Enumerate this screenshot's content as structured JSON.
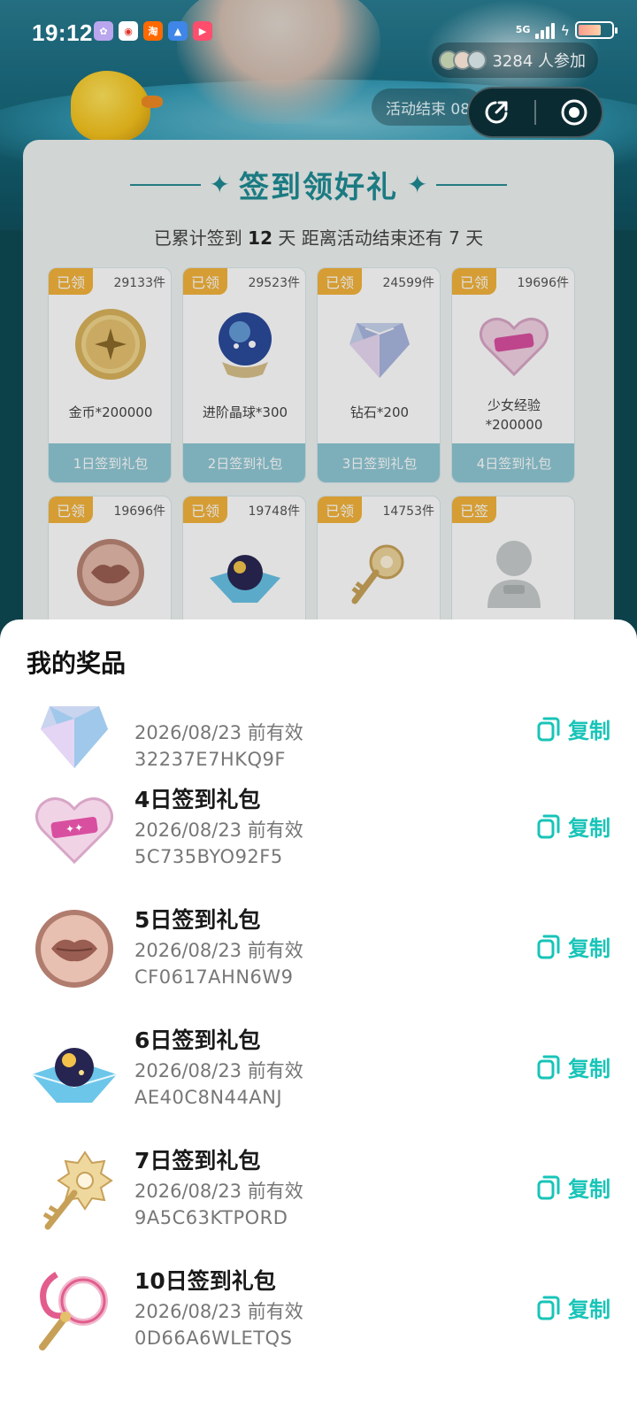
{
  "status_bar": {
    "time": "19:12",
    "network": "5G",
    "notif_apps": [
      "app-a",
      "weibo",
      "taobao",
      "game",
      "video"
    ]
  },
  "banner": {
    "participants": "3284 人参加",
    "end_tag": "活动结束 08"
  },
  "card": {
    "title": "签到领好礼",
    "sub_prefix": "已累计签到",
    "days": "12",
    "sub_mid": "天  距离活动结束还有",
    "remain": "7",
    "sub_suffix": "天",
    "gifts": [
      {
        "badge": "已领",
        "count": "29133件",
        "name": "金币*200000",
        "foot": "1日签到礼包",
        "icon": "gold-coin"
      },
      {
        "badge": "已领",
        "count": "29523件",
        "name": "进阶晶球*300",
        "foot": "2日签到礼包",
        "icon": "crystal-ball"
      },
      {
        "badge": "已领",
        "count": "24599件",
        "name": "钻石*200",
        "foot": "3日签到礼包",
        "icon": "diamond"
      },
      {
        "badge": "已领",
        "count": "19696件",
        "name": "少女经验*200000",
        "foot": "4日签到礼包",
        "icon": "heart-badge"
      },
      {
        "badge": "已领",
        "count": "19696件",
        "name": "",
        "foot": "",
        "icon": "lips-coin"
      },
      {
        "badge": "已领",
        "count": "19748件",
        "name": "",
        "foot": "",
        "icon": "golden-orb"
      },
      {
        "badge": "已领",
        "count": "14753件",
        "name": "",
        "foot": "",
        "icon": "golden-key"
      },
      {
        "badge": "已签",
        "count": "",
        "name": "",
        "foot": "",
        "icon": "locked-avatar"
      }
    ]
  },
  "sheet": {
    "title": "我的奖品",
    "copy_label": "复制",
    "prizes": [
      {
        "name": "",
        "valid": "2026/08/23 前有效",
        "code": "32237E7HKQ9F",
        "icon": "diamond"
      },
      {
        "name": "4日签到礼包",
        "valid": "2026/08/23 前有效",
        "code": "5C735BYO92F5",
        "icon": "heart-badge"
      },
      {
        "name": "5日签到礼包",
        "valid": "2026/08/23 前有效",
        "code": "CF0617AHN6W9",
        "icon": "lips-coin"
      },
      {
        "name": "6日签到礼包",
        "valid": "2026/08/23 前有效",
        "code": "AE40C8N44ANJ",
        "icon": "golden-orb"
      },
      {
        "name": "7日签到礼包",
        "valid": "2026/08/23 前有效",
        "code": "9A5C63KTPORD",
        "icon": "golden-key"
      },
      {
        "name": "10日签到礼包",
        "valid": "2026/08/23 前有效",
        "code": "0D66A6WLETQS",
        "icon": "magic-wand"
      }
    ]
  },
  "colors": {
    "accent": "#18c4b8",
    "title_teal": "#1f8c95",
    "badge_orange": "#f3b33c",
    "gift_foot": "#8fc8d4"
  }
}
